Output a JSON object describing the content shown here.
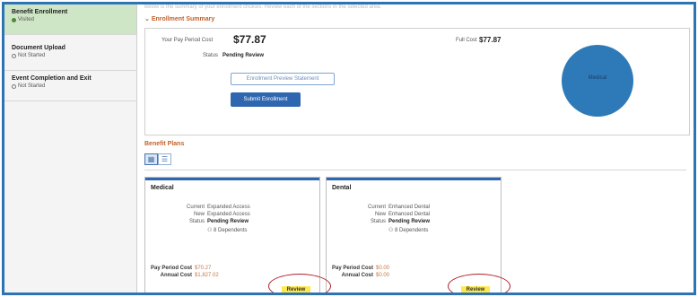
{
  "sidebar": {
    "steps": [
      {
        "title": "Benefit Enrollment",
        "status": "Visited"
      },
      {
        "title": "Document Upload",
        "status": "Not Started"
      },
      {
        "title": "Event Completion and Exit",
        "status": "Not Started"
      }
    ]
  },
  "top_text": "Below is the summary of your enrollment choices. Review each of the sections in the selected area.",
  "summary": {
    "title": "Enrollment Summary",
    "pay_period_label": "Your Pay Period Cost",
    "pay_period_value": "$77.87",
    "full_cost_label": "Full Cost",
    "full_cost_value": "$77.87",
    "status_label": "Status",
    "status_value": "Pending Review",
    "preview_button": "Enrollment Preview Statement",
    "submit_button": "Submit Enrollment",
    "pie_label": "Medical",
    "pie_color": "#2e7ab8"
  },
  "plans": {
    "title": "Benefit Plans",
    "cards": [
      {
        "title": "Medical",
        "current_label": "Current",
        "current_value": "Expanded Access",
        "new_label": "New",
        "new_value": "Expanded Access",
        "status_label": "Status",
        "status_value": "Pending Review",
        "dependents": "8 Dependents",
        "pay_label": "Pay Period Cost",
        "pay_value": "$70.27",
        "annual_label": "Annual Cost",
        "annual_value": "$1,827.02",
        "review": "Review"
      },
      {
        "title": "Dental",
        "current_label": "Current",
        "current_value": "Enhanced Dental",
        "new_label": "New",
        "new_value": "Enhanced Dental",
        "status_label": "Status",
        "status_value": "Pending Review",
        "dependents": "8 Dependents",
        "pay_label": "Pay Period Cost",
        "pay_value": "$0.00",
        "annual_label": "Annual Cost",
        "annual_value": "$0.00",
        "review": "Review"
      }
    ]
  },
  "colors": {
    "accent": "#2f66b0",
    "section_title": "#c2622c",
    "callout": "#b0202a",
    "highlight": "#ffe94a",
    "active_step": "#cfe6c6"
  }
}
